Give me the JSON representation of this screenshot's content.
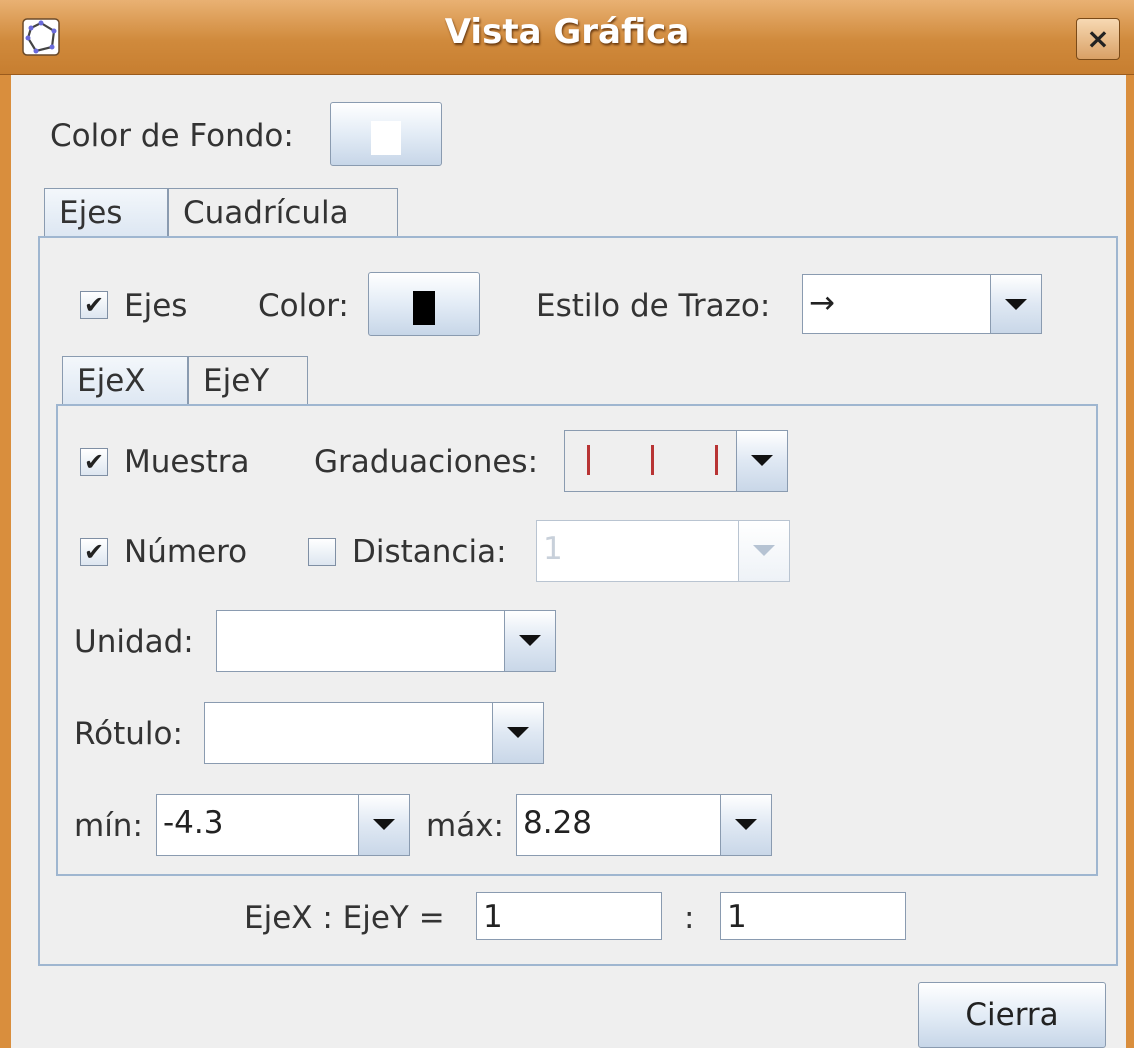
{
  "window": {
    "title": "Vista Gráfica",
    "close_symbol": "×"
  },
  "background": {
    "label": "Color de Fondo:",
    "color": "#ffffff"
  },
  "tabs": [
    {
      "label": "Ejes"
    },
    {
      "label": "Cuadrícula"
    }
  ],
  "axes": {
    "show_label": "Ejes",
    "show_checked": true,
    "color_label": "Color:",
    "color": "#000000",
    "line_style_label": "Estilo de Trazo:",
    "line_style_value": "→",
    "subtabs": [
      {
        "label": "EjeX"
      },
      {
        "label": "EjeY"
      }
    ]
  },
  "ejex": {
    "show_label": "Muestra",
    "show_checked": true,
    "ticks_label": "Graduaciones:",
    "ticks_value": "| | |",
    "number_label": "Número",
    "number_checked": true,
    "distance_label": "Distancia:",
    "distance_checked": false,
    "distance_value": "1",
    "unit_label": "Unidad:",
    "unit_value": "",
    "label_label": "Rótulo:",
    "label_value": "",
    "min_label": "mín:",
    "min_value": "-4.3",
    "max_label": "máx:",
    "max_value": "8.28"
  },
  "ratio": {
    "label": "EjeX : EjeY =",
    "x_value": "1",
    "separator": ":",
    "y_value": "1"
  },
  "footer": {
    "close_label": "Cierra"
  },
  "colors": {
    "titlebar": "#d08a3c",
    "accent": "#9fb6d0"
  }
}
